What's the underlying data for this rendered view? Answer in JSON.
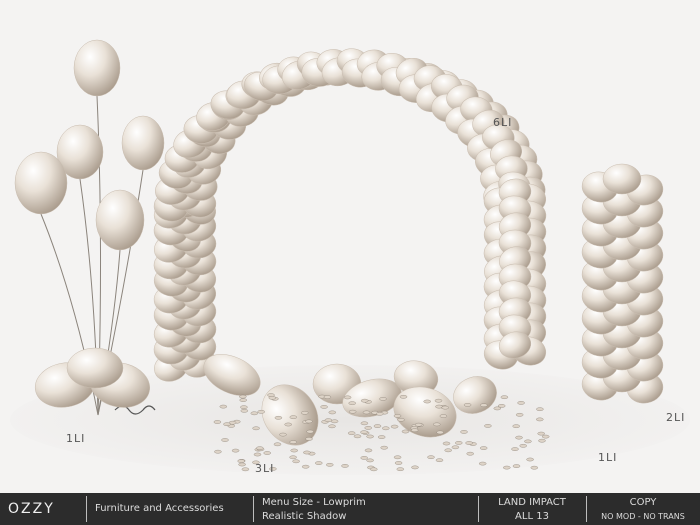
{
  "labels": {
    "arch": "6LI",
    "column": "2LI",
    "bouquet": "1LI",
    "scattered": "3LI",
    "confetti": "1LI"
  },
  "footer": {
    "brand": "OZZY",
    "category": "Furniture and Accessories",
    "menu_line1": "Menu Size - Lowprim",
    "menu_line2": "Realistic Shadow",
    "land_impact_title": "LAND IMPACT",
    "land_impact_value": "ALL 13",
    "perm_title": "COPY",
    "perm_value": "NO MOD - NO TRANS"
  },
  "colors": {
    "balloon": "#e7dfd5",
    "balloon_shade": "#b5a89a",
    "background": "#f4f3f2",
    "footer_bg": "#2c2c2c"
  }
}
